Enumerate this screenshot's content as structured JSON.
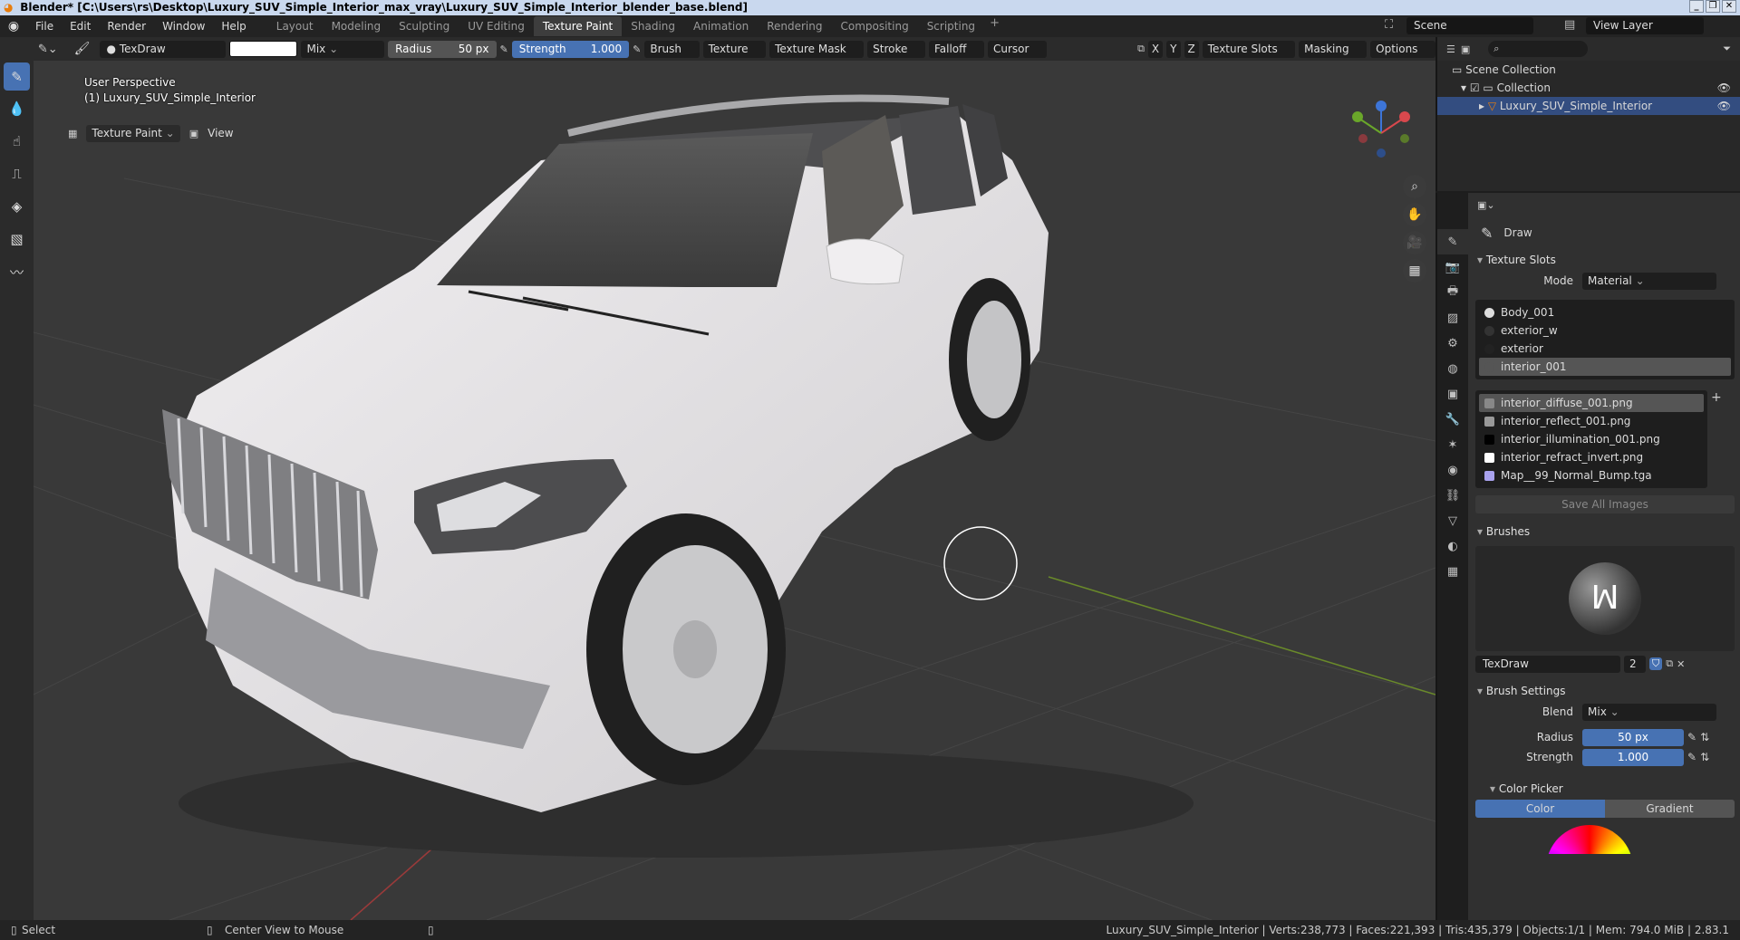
{
  "window": {
    "title": "Blender* [C:\\Users\\rs\\Desktop\\Luxury_SUV_Simple_Interior_max_vray\\Luxury_SUV_Simple_Interior_blender_base.blend]",
    "controls": [
      "_",
      "❐",
      "✕"
    ]
  },
  "menubar": {
    "items": [
      "File",
      "Edit",
      "Render",
      "Window",
      "Help"
    ]
  },
  "workspaces": [
    "Layout",
    "Modeling",
    "Sculpting",
    "UV Editing",
    "Texture Paint",
    "Shading",
    "Animation",
    "Rendering",
    "Compositing",
    "Scripting"
  ],
  "active_workspace": "Texture Paint",
  "scene": {
    "name": "Scene",
    "view_layer": "View Layer"
  },
  "tool_header": {
    "brush_name": "TexDraw",
    "blend": "Mix",
    "radius_label": "Radius",
    "radius_value": "50 px",
    "strength_label": "Strength",
    "strength_value": "1.000",
    "menus": [
      "Brush",
      "Texture",
      "Texture Mask",
      "Stroke",
      "Falloff",
      "Cursor"
    ],
    "axes": [
      "X",
      "Y",
      "Z"
    ],
    "right_menus": [
      "Texture Slots",
      "Masking",
      "Options"
    ]
  },
  "viewport_header": {
    "mode": "Texture Paint",
    "view": "View"
  },
  "viewport": {
    "perspective": "User Perspective",
    "object": "(1) Luxury_SUV_Simple_Interior"
  },
  "outliner": {
    "scene_collection": "Scene Collection",
    "collection": "Collection",
    "object": "Luxury_SUV_Simple_Interior"
  },
  "properties": {
    "tool_name": "Draw",
    "texture_slots": {
      "title": "Texture Slots",
      "mode_label": "Mode",
      "mode_value": "Material",
      "materials": [
        "Body_001",
        "exterior_w",
        "exterior",
        "interior_001"
      ],
      "selected_material": "interior_001",
      "images": [
        "interior_diffuse_001.png",
        "interior_reflect_001.png",
        "interior_illumination_001.png",
        "interior_refract_invert.png",
        "Map__99_Normal_Bump.tga"
      ],
      "selected_image": "interior_diffuse_001.png",
      "save_all": "Save All Images"
    },
    "brushes": {
      "title": "Brushes",
      "brush_name": "TexDraw",
      "users": "2"
    },
    "brush_settings": {
      "title": "Brush Settings",
      "blend_label": "Blend",
      "blend_value": "Mix",
      "radius_label": "Radius",
      "radius_value": "50 px",
      "strength_label": "Strength",
      "strength_value": "1.000"
    },
    "color_picker": {
      "title": "Color Picker",
      "tab_color": "Color",
      "tab_gradient": "Gradient"
    }
  },
  "statusbar": {
    "select": "Select",
    "center_view": "Center View to Mouse",
    "stats": "Luxury_SUV_Simple_Interior | Verts:238,773 | Faces:221,393 | Tris:435,379 | Objects:1/1 | Mem: 794.0 MiB | 2.83.1"
  },
  "colors": {
    "accent": "#4772b3",
    "viewport_bg": "#393939",
    "car_body": "#e4e2e4"
  }
}
